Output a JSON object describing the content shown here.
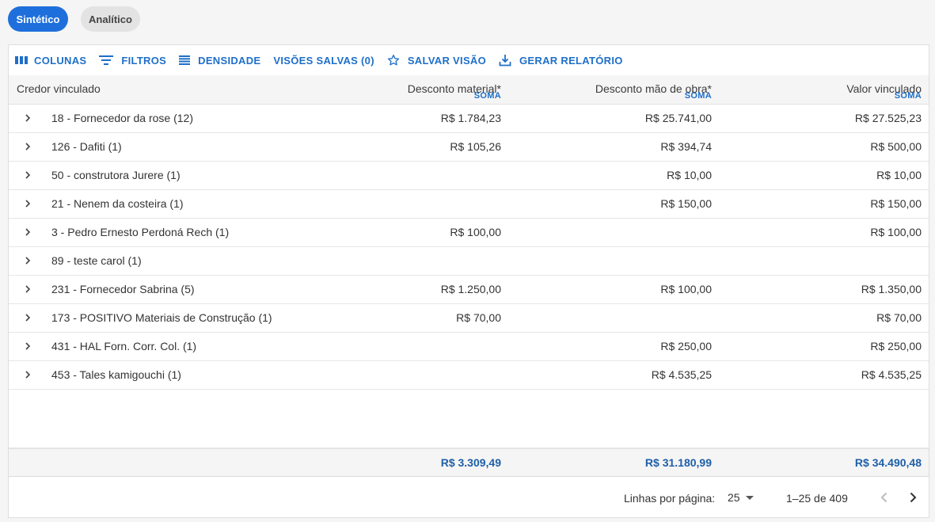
{
  "view_toggle": {
    "synthetic": "Sintético",
    "analytic": "Analítico"
  },
  "toolbar": {
    "columns": "COLUNAS",
    "filters": "FILTROS",
    "density": "DENSIDADE",
    "saved_views": "VISÕES SALVAS (0)",
    "save_view": "SALVAR VISÃO",
    "generate_report": "GERAR RELATÓRIO"
  },
  "columns": {
    "creditor": "Credor vinculado",
    "material_discount": "Desconto material*",
    "labor_discount": "Desconto mão de obra*",
    "linked_value": "Valor vinculado",
    "aggregate": "SOMA"
  },
  "rows": [
    {
      "name": "18 - Fornecedor da rose (12)",
      "material": "R$ 1.784,23",
      "labor": "R$ 25.741,00",
      "value": "R$ 27.525,23"
    },
    {
      "name": "126 - Dafiti (1)",
      "material": "R$ 105,26",
      "labor": "R$ 394,74",
      "value": "R$ 500,00"
    },
    {
      "name": "50 - construtora Jurere (1)",
      "material": "",
      "labor": "R$ 10,00",
      "value": "R$ 10,00"
    },
    {
      "name": "21 - Nenem da costeira (1)",
      "material": "",
      "labor": "R$ 150,00",
      "value": "R$ 150,00"
    },
    {
      "name": "3 - Pedro Ernesto Perdoná Rech (1)",
      "material": "R$ 100,00",
      "labor": "",
      "value": "R$ 100,00"
    },
    {
      "name": "89 - teste carol (1)",
      "material": "",
      "labor": "",
      "value": ""
    },
    {
      "name": "231 - Fornecedor Sabrina (5)",
      "material": "R$ 1.250,00",
      "labor": "R$ 100,00",
      "value": "R$ 1.350,00"
    },
    {
      "name": "173 - POSITIVO Materiais de Construção (1)",
      "material": "R$ 70,00",
      "labor": "",
      "value": "R$ 70,00"
    },
    {
      "name": "431 - HAL Forn. Corr. Col. (1)",
      "material": "",
      "labor": "R$ 250,00",
      "value": "R$ 250,00"
    },
    {
      "name": "453 - Tales kamigouchi (1)",
      "material": "",
      "labor": "R$ 4.535,25",
      "value": "R$ 4.535,25"
    }
  ],
  "totals": {
    "material": "R$ 3.309,49",
    "labor": "R$ 31.180,99",
    "value": "R$ 34.490,48"
  },
  "pagination": {
    "rows_per_page_label": "Linhas por página:",
    "rows_per_page": "25",
    "range": "1–25 de 409"
  },
  "colors": {
    "accent": "#1e6fdc",
    "link": "#1e6fc8",
    "total": "#1e5fa8"
  }
}
